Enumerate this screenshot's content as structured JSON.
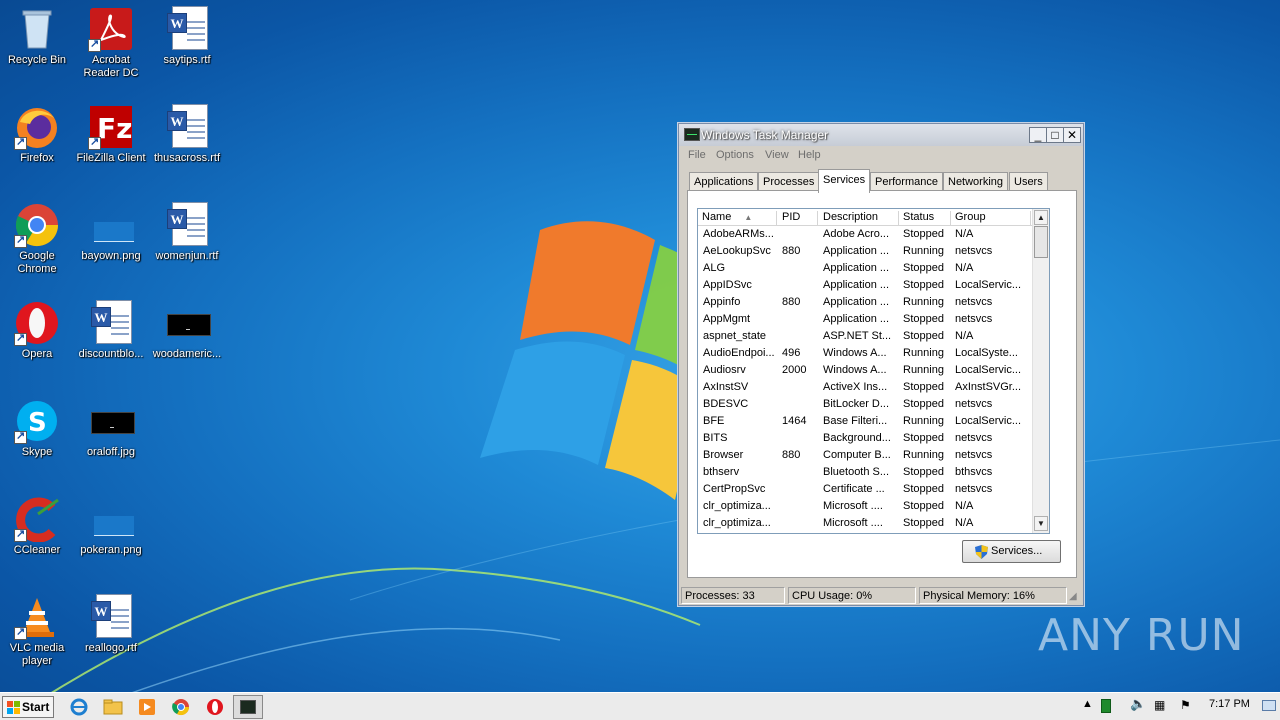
{
  "desktop": {
    "icons": [
      {
        "label": "Recycle Bin"
      },
      {
        "label": "Acrobat Reader DC"
      },
      {
        "label": "saytips.rtf"
      },
      {
        "label": "Firefox"
      },
      {
        "label": "FileZilla Client"
      },
      {
        "label": "thusacross.rtf"
      },
      {
        "label": "Google Chrome"
      },
      {
        "label": "bayown.png"
      },
      {
        "label": "womenjun.rtf"
      },
      {
        "label": "Opera"
      },
      {
        "label": "discountblo..."
      },
      {
        "label": "woodameric..."
      },
      {
        "label": "Skype"
      },
      {
        "label": "oraloff.jpg"
      },
      {
        "label": "CCleaner"
      },
      {
        "label": "pokeran.png"
      },
      {
        "label": "VLC media player"
      },
      {
        "label": "reallogo.rtf"
      }
    ],
    "watermark": "ANY RUN"
  },
  "task_manager": {
    "title": "Windows Task Manager",
    "menu": [
      "File",
      "Options",
      "View",
      "Help"
    ],
    "tabs": [
      "Applications",
      "Processes",
      "Services",
      "Performance",
      "Networking",
      "Users"
    ],
    "active_tab": "Services",
    "columns": [
      "Name",
      "PID",
      "Description",
      "Status",
      "Group"
    ],
    "rows": [
      [
        "AdobeARMs...",
        "",
        "Adobe Acro...",
        "Stopped",
        "N/A"
      ],
      [
        "AeLookupSvc",
        "880",
        "Application ...",
        "Running",
        "netsvcs"
      ],
      [
        "ALG",
        "",
        "Application ...",
        "Stopped",
        "N/A"
      ],
      [
        "AppIDSvc",
        "",
        "Application ...",
        "Stopped",
        "LocalServic..."
      ],
      [
        "Appinfo",
        "880",
        "Application ...",
        "Running",
        "netsvcs"
      ],
      [
        "AppMgmt",
        "",
        "Application ...",
        "Stopped",
        "netsvcs"
      ],
      [
        "aspnet_state",
        "",
        "ASP.NET St...",
        "Stopped",
        "N/A"
      ],
      [
        "AudioEndpoi...",
        "496",
        "Windows A...",
        "Running",
        "LocalSyste..."
      ],
      [
        "Audiosrv",
        "2000",
        "Windows A...",
        "Running",
        "LocalServic..."
      ],
      [
        "AxInstSV",
        "",
        "ActiveX Ins...",
        "Stopped",
        "AxInstSVGr..."
      ],
      [
        "BDESVC",
        "",
        "BitLocker D...",
        "Stopped",
        "netsvcs"
      ],
      [
        "BFE",
        "1464",
        "Base Filteri...",
        "Running",
        "LocalServic..."
      ],
      [
        "BITS",
        "",
        "Background...",
        "Stopped",
        "netsvcs"
      ],
      [
        "Browser",
        "880",
        "Computer B...",
        "Running",
        "netsvcs"
      ],
      [
        "bthserv",
        "",
        "Bluetooth S...",
        "Stopped",
        "bthsvcs"
      ],
      [
        "CertPropSvc",
        "",
        "Certificate ...",
        "Stopped",
        "netsvcs"
      ],
      [
        "clr_optimiza...",
        "",
        "Microsoft ....",
        "Stopped",
        "N/A"
      ],
      [
        "clr_optimiza...",
        "",
        "Microsoft ....",
        "Stopped",
        "N/A"
      ]
    ],
    "services_button": "Services...",
    "status": {
      "processes": "Processes: 33",
      "cpu": "CPU Usage: 0%",
      "memory": "Physical Memory: 16%"
    }
  },
  "taskbar": {
    "start_label": "Start",
    "clock": "7:17 PM"
  }
}
